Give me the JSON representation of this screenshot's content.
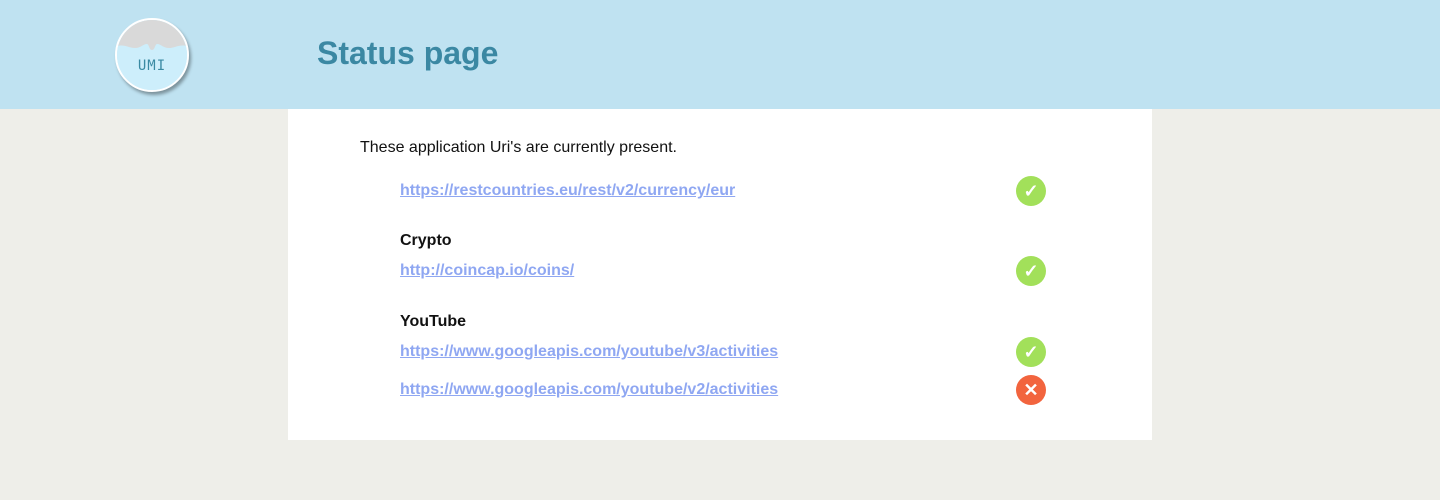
{
  "header": {
    "logo_text": "UMI",
    "title": "Status page"
  },
  "content": {
    "intro": "These application Uri's are currently present.",
    "colors": {
      "ok": "#a2e05a",
      "error": "#f2643e",
      "link": "#8fa7f2"
    },
    "items": [
      {
        "group": "",
        "url": "https://restcountries.eu/rest/v2/currency/eur",
        "status": "ok",
        "icon": "check-icon"
      },
      {
        "group": "Crypto",
        "url": "http://coincap.io/coins/",
        "status": "ok",
        "icon": "check-icon"
      },
      {
        "group": "YouTube",
        "url": "https://www.googleapis.com/youtube/v3/activities",
        "status": "ok",
        "icon": "check-icon"
      },
      {
        "group": "",
        "url": "https://www.googleapis.com/youtube/v2/activities",
        "status": "error",
        "icon": "cross-icon"
      }
    ]
  }
}
